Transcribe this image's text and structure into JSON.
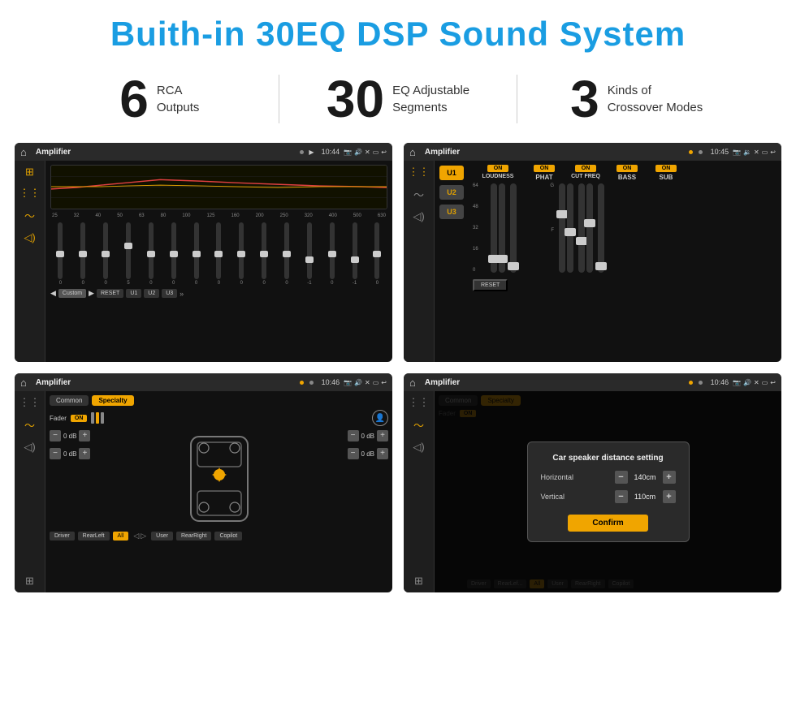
{
  "header": {
    "title": "Buith-in 30EQ DSP Sound System"
  },
  "stats": [
    {
      "number": "6",
      "text_line1": "RCA",
      "text_line2": "Outputs"
    },
    {
      "number": "30",
      "text_line1": "EQ Adjustable",
      "text_line2": "Segments"
    },
    {
      "number": "3",
      "text_line1": "Kinds of",
      "text_line2": "Crossover Modes"
    }
  ],
  "screens": [
    {
      "id": "screen-eq",
      "statusbar": {
        "title": "Amplifier",
        "time": "10:44"
      },
      "freq_labels": [
        "25",
        "32",
        "40",
        "50",
        "63",
        "80",
        "100",
        "125",
        "160",
        "200",
        "250",
        "320",
        "400",
        "500",
        "630"
      ],
      "eq_values": [
        "0",
        "0",
        "0",
        "5",
        "0",
        "0",
        "0",
        "0",
        "0",
        "0",
        "0",
        "-1",
        "0",
        "-1"
      ],
      "preset": "Custom",
      "buttons": [
        "RESET",
        "U1",
        "U2",
        "U3"
      ]
    },
    {
      "id": "screen-amp",
      "statusbar": {
        "title": "Amplifier",
        "time": "10:45"
      },
      "channels": [
        "LOUDNESS",
        "PHAT",
        "CUT FREQ",
        "BASS",
        "SUB"
      ],
      "u_buttons": [
        "U1",
        "U2",
        "U3"
      ],
      "reset_btn": "RESET"
    },
    {
      "id": "screen-fader",
      "statusbar": {
        "title": "Amplifier",
        "time": "10:46"
      },
      "tabs": [
        "Common",
        "Specialty"
      ],
      "fader_label": "Fader",
      "fader_on": "ON",
      "db_values": [
        "0 dB",
        "0 dB",
        "0 dB",
        "0 dB"
      ],
      "bottom_buttons": [
        "Driver",
        "RearLeft",
        "All",
        "User",
        "RearRight",
        "Copilot"
      ]
    },
    {
      "id": "screen-dist",
      "statusbar": {
        "title": "Amplifier",
        "time": "10:46"
      },
      "tabs": [
        "Common",
        "Specialty"
      ],
      "modal": {
        "title": "Car speaker distance setting",
        "horizontal_label": "Horizontal",
        "horizontal_value": "140cm",
        "vertical_label": "Vertical",
        "vertical_value": "110cm",
        "confirm_label": "Confirm"
      },
      "bottom_buttons": [
        "Driver",
        "RearLeft",
        "All",
        "User",
        "RearRight",
        "Copilot"
      ]
    }
  ]
}
